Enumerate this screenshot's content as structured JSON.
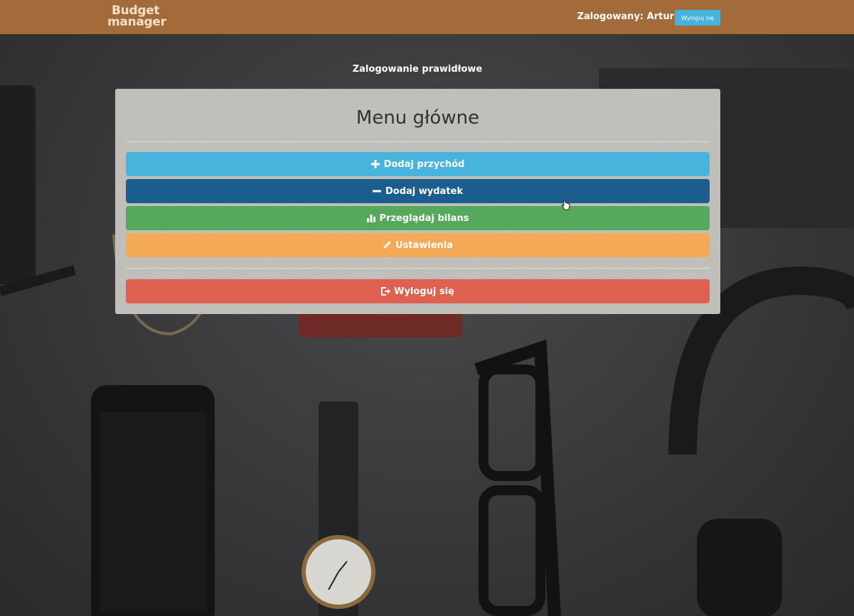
{
  "navbar": {
    "brand_line1": "Budget",
    "brand_line2": "manager",
    "login_label": "Zalogowany: ",
    "username": "Artur",
    "logout_label": "Wyloguj się",
    "background_color": "#a36b3a",
    "brand_color": "#f3e0c6"
  },
  "status": {
    "message": "Zalogowanie prawidłowe"
  },
  "menu": {
    "title": "Menu główne",
    "items": [
      {
        "label": "Dodaj przychód",
        "icon": "plus-icon",
        "color": "#48b3dc"
      },
      {
        "label": "Dodaj wydatek",
        "icon": "minus-icon",
        "color": "#1b5d8f"
      },
      {
        "label": "Przeglądaj bilans",
        "icon": "bar-chart-icon",
        "color": "#55a85c"
      },
      {
        "label": "Ustawienia",
        "icon": "wrench-icon",
        "color": "#f4aa55"
      }
    ],
    "logout": {
      "label": "Wyloguj się",
      "icon": "logout-icon",
      "color": "#e06050"
    }
  }
}
